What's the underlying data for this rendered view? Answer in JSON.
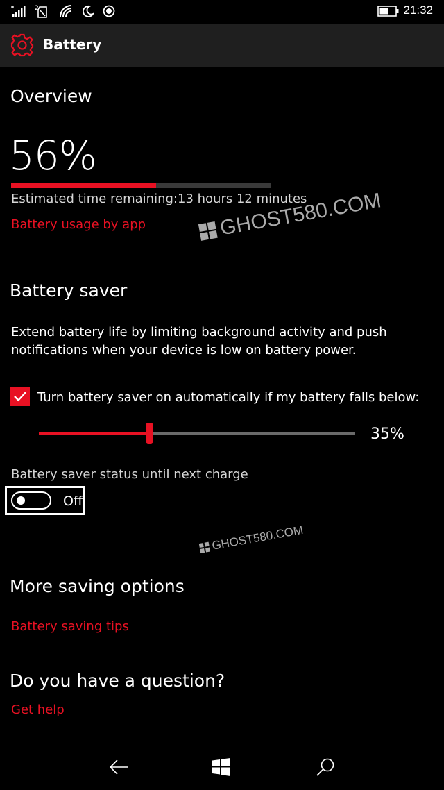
{
  "status_bar": {
    "signal_icon": "signal-bars-icon",
    "sim_badge": "2",
    "time": "21:32",
    "battery_level": 0.56
  },
  "header": {
    "icon": "gear-icon",
    "title": "Battery"
  },
  "overview": {
    "title": "Overview",
    "percent": "56%",
    "level": 56,
    "estimate": "Estimated time remaining:13 hours 12 minutes",
    "usage_link": "Battery usage by app"
  },
  "battery_saver": {
    "title": "Battery saver",
    "description": "Extend battery life by limiting background activity and push notifications when your device is low on battery power.",
    "auto_checkbox_label": "Turn battery saver on automatically if my battery falls below:",
    "auto_checked": true,
    "threshold_value": 35,
    "threshold_label": "35%",
    "status_label": "Battery saver status until next charge",
    "toggle_state": "Off"
  },
  "more_options": {
    "title": "More saving options",
    "tips_link": "Battery saving tips"
  },
  "question": {
    "title": "Do you have a question?",
    "help_link": "Get help"
  },
  "nav_bar": {
    "back_icon": "back-arrow-icon",
    "start_icon": "windows-start-icon",
    "search_icon": "search-icon"
  },
  "watermark": {
    "text_large": "GHOST580.COM",
    "text_small": "GHOST580.COM"
  },
  "colors": {
    "accent": "#e81123",
    "background": "#000000",
    "header_bg": "#1f1f1f"
  }
}
